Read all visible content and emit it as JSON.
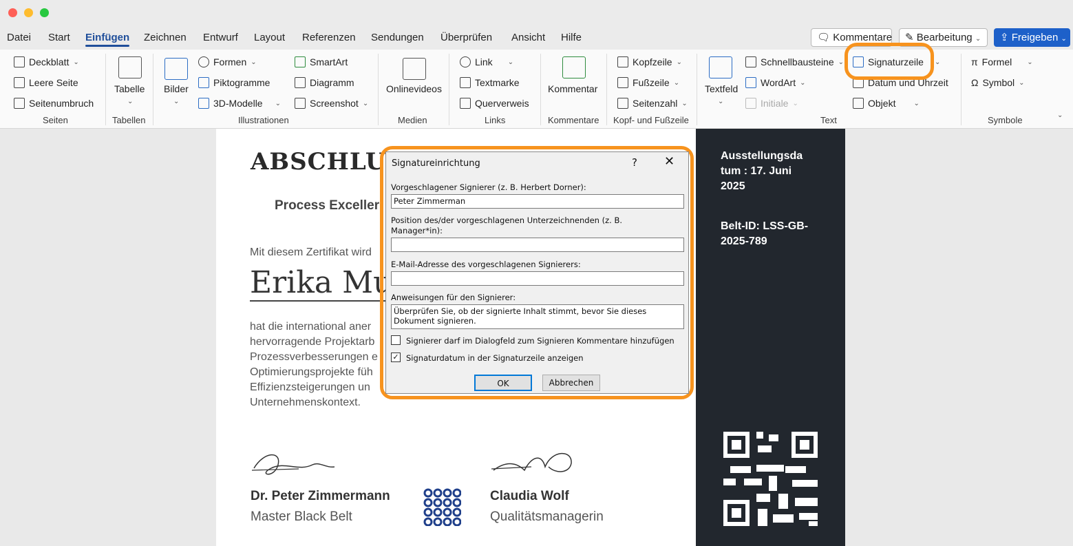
{
  "menu": {
    "items": [
      "Datei",
      "Start",
      "Einfügen",
      "Zeichnen",
      "Entwurf",
      "Layout",
      "Referenzen",
      "Sendungen",
      "Überprüfen",
      "Ansicht",
      "Hilfe"
    ],
    "active": "Einfügen"
  },
  "top_buttons": {
    "comments": "Kommentare",
    "editing": "Bearbeitung",
    "share": "Freigeben"
  },
  "ribbon": {
    "seiten": {
      "group": "Seiten",
      "deckblatt": "Deckblatt",
      "leere_seite": "Leere Seite",
      "seitenumbruch": "Seitenumbruch"
    },
    "tabellen": {
      "group": "Tabellen",
      "tabelle": "Tabelle"
    },
    "illustrationen": {
      "group": "Illustrationen",
      "bilder": "Bilder",
      "formen": "Formen",
      "piktogramme": "Piktogramme",
      "modelle_3d": "3D-Modelle",
      "smartart": "SmartArt",
      "diagramm": "Diagramm",
      "screenshot": "Screenshot"
    },
    "medien": {
      "group": "Medien",
      "onlinevideos": "Onlinevideos"
    },
    "links": {
      "group": "Links",
      "link": "Link",
      "textmarke": "Textmarke",
      "querverweis": "Querverweis"
    },
    "kommentare": {
      "group": "Kommentare",
      "kommentar": "Kommentar"
    },
    "kopf_fuss": {
      "group": "Kopf- und Fußzeile",
      "kopfzeile": "Kopfzeile",
      "fusszeile": "Fußzeile",
      "seitenzahl": "Seitenzahl"
    },
    "text": {
      "group": "Text",
      "textfeld": "Textfeld",
      "schnellbausteine": "Schnellbausteine",
      "wordart": "WordArt",
      "initiale": "Initiale",
      "signaturzeile": "Signaturzeile",
      "datum_uhrzeit": "Datum und Uhrzeit",
      "objekt": "Objekt"
    },
    "symbole": {
      "group": "Symbole",
      "formel": "Formel",
      "symbol": "Symbol"
    }
  },
  "document": {
    "title": "ABSCHLUS",
    "subtitle": "Process Exceller",
    "intro": "Mit diesem Zertifikat wird",
    "name": "Erika Mu",
    "body_lines": [
      "hat die international aner",
      "hervorragende Projektarb",
      "Prozessverbesserungen e",
      "Optimierungsprojekte füh",
      "Effizienzsteigerungen un",
      "Unternehmenskontext."
    ],
    "signer1_name": "Dr. Peter Zimmermann",
    "signer1_role": "Master Black Belt",
    "signer2_name": "Claudia Wolf",
    "signer2_role": "Qualitätsmanagerin",
    "side_date": "Ausstellungsda tum : 17. Juni 2025",
    "side_id": "Belt-ID: LSS-GB-2025-789"
  },
  "dialog": {
    "title": "Signatureinrichtung",
    "help": "?",
    "close": "✕",
    "signer_label": "Vorgeschlagener Signierer (z. B. Herbert Dorner):",
    "signer_value": "Peter Zimmerman",
    "position_label_1": "Position des/der vorgeschlagenen Unterzeichnenden (z. B.",
    "position_label_2": "Manager*in):",
    "position_value": "",
    "email_label": "E-Mail-Adresse des vorgeschlagenen Signierers:",
    "email_value": "",
    "instructions_label": "Anweisungen für den Signierer:",
    "instructions_value": "Überprüfen Sie, ob der signierte Inhalt stimmt, bevor Sie dieses Dokument signieren.",
    "allow_comments_label": "Signierer darf im Dialogfeld zum Signieren Kommentare hinzufügen",
    "allow_comments_checked": false,
    "show_date_label": "Signaturdatum in der Signaturzeile anzeigen",
    "show_date_checked": true,
    "ok": "OK",
    "cancel": "Abbrechen"
  },
  "colors": {
    "highlight": "#f7931e",
    "accent": "#1f4e9a",
    "share_button": "#1d60c9",
    "sidebar_dark": "#22272e"
  }
}
